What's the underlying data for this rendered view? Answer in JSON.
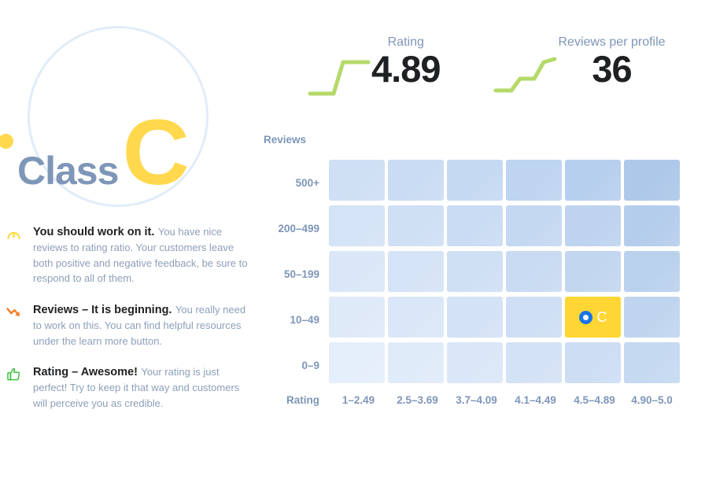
{
  "badge": {
    "label": "Class",
    "letter": "C",
    "circle_color": "#e1ecf9",
    "dot_color": "#ffd84d",
    "label_color": "#7e96b8",
    "letter_color": "#ffd84d"
  },
  "metrics": [
    {
      "label": "Rating",
      "value": "4.89",
      "spark": "step-up-sharp",
      "spark_color": "#b5d96a"
    },
    {
      "label": "Reviews per profile",
      "value": "36",
      "spark": "step-up-gradual",
      "spark_color": "#b5d96a"
    }
  ],
  "tips": [
    {
      "icon": "gauge-icon",
      "icon_color": "#ffd633",
      "title": "You should work on it.",
      "desc": "You have nice reviews to rating ratio. Your customers leave both positive and negative feedback, be sure to respond to all of them."
    },
    {
      "icon": "trend-down-icon",
      "icon_color": "#f57c20",
      "title": "Reviews – It is beginning.",
      "desc": "You really need to work on this. You can find helpful resources under the learn more button."
    },
    {
      "icon": "thumbs-up-icon",
      "icon_color": "#3fc13f",
      "title": "Rating – Awesome!",
      "desc": "Your rating is just perfect! Try to keep it that way and customers will perceive you as credible."
    }
  ],
  "chart_data": {
    "type": "heatmap",
    "title": "",
    "xlabel": "Rating",
    "ylabel": "Reviews",
    "grid": false,
    "legend": "none",
    "categories_x": [
      "1–2.49",
      "2.5–3.69",
      "3.7–4.09",
      "4.1–4.49",
      "4.5–4.89",
      "4.90–5.0"
    ],
    "categories_y": [
      "500+",
      "200–499",
      "50–199",
      "10–49",
      "0–9"
    ],
    "cell_colors": [
      [
        "#cfdff4",
        "#cadcf3",
        "#c5d9f2",
        "#bed4f0",
        "#b7cfee",
        "#aec8ea"
      ],
      [
        "#d4e3f6",
        "#cfdff4",
        "#cadcf3",
        "#c4d8f1",
        "#bdd3ef",
        "#b5cdec"
      ],
      [
        "#dae7f8",
        "#d5e3f6",
        "#cfdff4",
        "#c9dbf2",
        "#c2d6f0",
        "#bad1ed"
      ],
      [
        "#dfeaf9",
        "#dae7f8",
        "#d4e2f6",
        "#cedef4",
        "#ffd633",
        "#bfd5ef"
      ],
      [
        "#e5eefb",
        "#e0ebf9",
        "#dae7f8",
        "#d4e2f6",
        "#cdddf4",
        "#c5d9f1"
      ]
    ],
    "highlight": {
      "row_label": "10–49",
      "col_label": "4.5–4.89",
      "row_index": 3,
      "col_index": 4,
      "letter": "C",
      "cell_color": "#ffd633",
      "marker_color": "#1a73e8"
    },
    "values": [
      [
        1,
        1,
        1,
        1,
        1,
        1
      ],
      [
        1,
        1,
        1,
        1,
        1,
        1
      ],
      [
        1,
        1,
        1,
        1,
        1,
        1
      ],
      [
        1,
        1,
        1,
        1,
        1,
        1
      ],
      [
        1,
        1,
        1,
        1,
        1,
        1
      ]
    ]
  }
}
